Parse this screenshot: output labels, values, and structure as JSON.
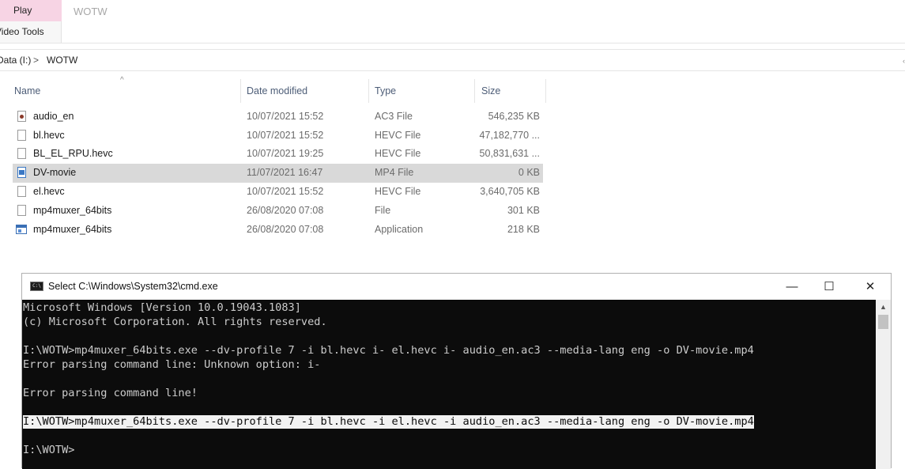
{
  "ribbon": {
    "play_tab": "Play",
    "video_tools_tab": "Video Tools",
    "window_title": "WOTW"
  },
  "address": {
    "drive": "Data (I:)",
    "separator": ">",
    "folder": "WOTW"
  },
  "columns": {
    "name": "Name",
    "date": "Date modified",
    "type": "Type",
    "size": "Size"
  },
  "files": [
    {
      "name": "audio_en",
      "date": "10/07/2021 15:52",
      "type": "AC3 File",
      "size": "546,235 KB",
      "icon": "audio-file-icon"
    },
    {
      "name": "bl.hevc",
      "date": "10/07/2021 15:52",
      "type": "HEVC File",
      "size": "47,182,770 ...",
      "icon": "file-icon"
    },
    {
      "name": "BL_EL_RPU.hevc",
      "date": "10/07/2021 19:25",
      "type": "HEVC File",
      "size": "50,831,631 ...",
      "icon": "file-icon"
    },
    {
      "name": "DV-movie",
      "date": "11/07/2021 16:47",
      "type": "MP4 File",
      "size": "0 KB",
      "icon": "video-file-icon"
    },
    {
      "name": "el.hevc",
      "date": "10/07/2021 15:52",
      "type": "HEVC File",
      "size": "3,640,705 KB",
      "icon": "file-icon"
    },
    {
      "name": "mp4muxer_64bits",
      "date": "26/08/2020 07:08",
      "type": "File",
      "size": "301 KB",
      "icon": "file-icon"
    },
    {
      "name": "mp4muxer_64bits",
      "date": "26/08/2020 07:08",
      "type": "Application",
      "size": "218 KB",
      "icon": "application-icon"
    }
  ],
  "cmd": {
    "title": "Select C:\\Windows\\System32\\cmd.exe",
    "icon_label": "C:\\",
    "minimize": "—",
    "maximize": "☐",
    "close": "✕",
    "lines": [
      "Microsoft Windows [Version 10.0.19043.1083]",
      "(c) Microsoft Corporation. All rights reserved.",
      "",
      "I:\\WOTW>mp4muxer_64bits.exe --dv-profile 7 -i bl.hevc i- el.hevc i- audio_en.ac3 --media-lang eng -o DV-movie.mp4",
      "Error parsing command line: Unknown option: i-",
      "",
      "Error parsing command line!",
      "",
      "I:\\WOTW>mp4muxer_64bits.exe --dv-profile 7 -i bl.hevc -i el.hevc -i audio_en.ac3 --media-lang eng -o DV-movie.mp4",
      "",
      "I:\\WOTW>"
    ]
  }
}
